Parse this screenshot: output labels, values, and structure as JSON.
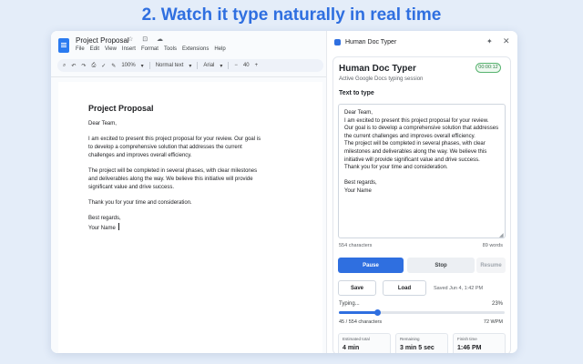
{
  "headline": "2. Watch it type naturally in real time",
  "docs": {
    "title": "Project Proposal",
    "title_icons": "☆ ⊡ ☁",
    "menu": [
      "File",
      "Edit",
      "View",
      "Insert",
      "Format",
      "Tools",
      "Extensions",
      "Help"
    ],
    "toolbar": {
      "zoom": "100%",
      "style": "Normal text",
      "font": "Arial",
      "font_size": "40"
    },
    "content": {
      "heading": "Project Proposal",
      "greeting": "Dear Team,",
      "para1": "I am excited to present this project proposal for your review. Our goal is to develop a comprehensive solution that addresses the current challenges and improves overall efficiency.",
      "para2": "The project will be completed in several phases, with clear milestones and deliverables along the way. We believe this initiative will provide significant value and drive success.",
      "para3": "Thank you for your time and consideration.",
      "closing": "Best regards,",
      "name": "Your Name"
    }
  },
  "panel": {
    "header_title": "Human Doc Typer",
    "app_title": "Human Doc Typer",
    "subtitle": "Active Google Docs typing session",
    "timer": "00:00:12",
    "text_label": "Text to type",
    "text": "Dear Team,\nI am excited to present this project proposal for your review. Our goal is to develop a comprehensive solution that addresses the current challenges and improves overall efficiency.\nThe project will be completed in several phases, with clear milestones and deliverables along the way. We believe this initiative will provide significant value and drive success.\nThank you for your time and consideration.\n\nBest regards,\nYour Name",
    "char_count": "554 characters",
    "word_count": "89 words",
    "buttons": {
      "pause": "Pause",
      "stop": "Stop",
      "resume": "Resume",
      "save": "Save",
      "load": "Load"
    },
    "saved_text": "Saved Jun 4, 1:42 PM",
    "typing_label": "Typing...",
    "progress_percent": 23,
    "progress_text": "23%",
    "progress_count": "45 / 554 characters",
    "wpm": "72 WPM",
    "stats": [
      {
        "label": "Estimated total",
        "value": "4 min"
      },
      {
        "label": "Remaining",
        "value": "3 min 5 sec"
      },
      {
        "label": "Finish time",
        "value": "1:46 PM"
      }
    ]
  },
  "colors": {
    "accent": "#2f6fe0",
    "background": "#e4edf9",
    "timer_green": "#2e7d46"
  }
}
